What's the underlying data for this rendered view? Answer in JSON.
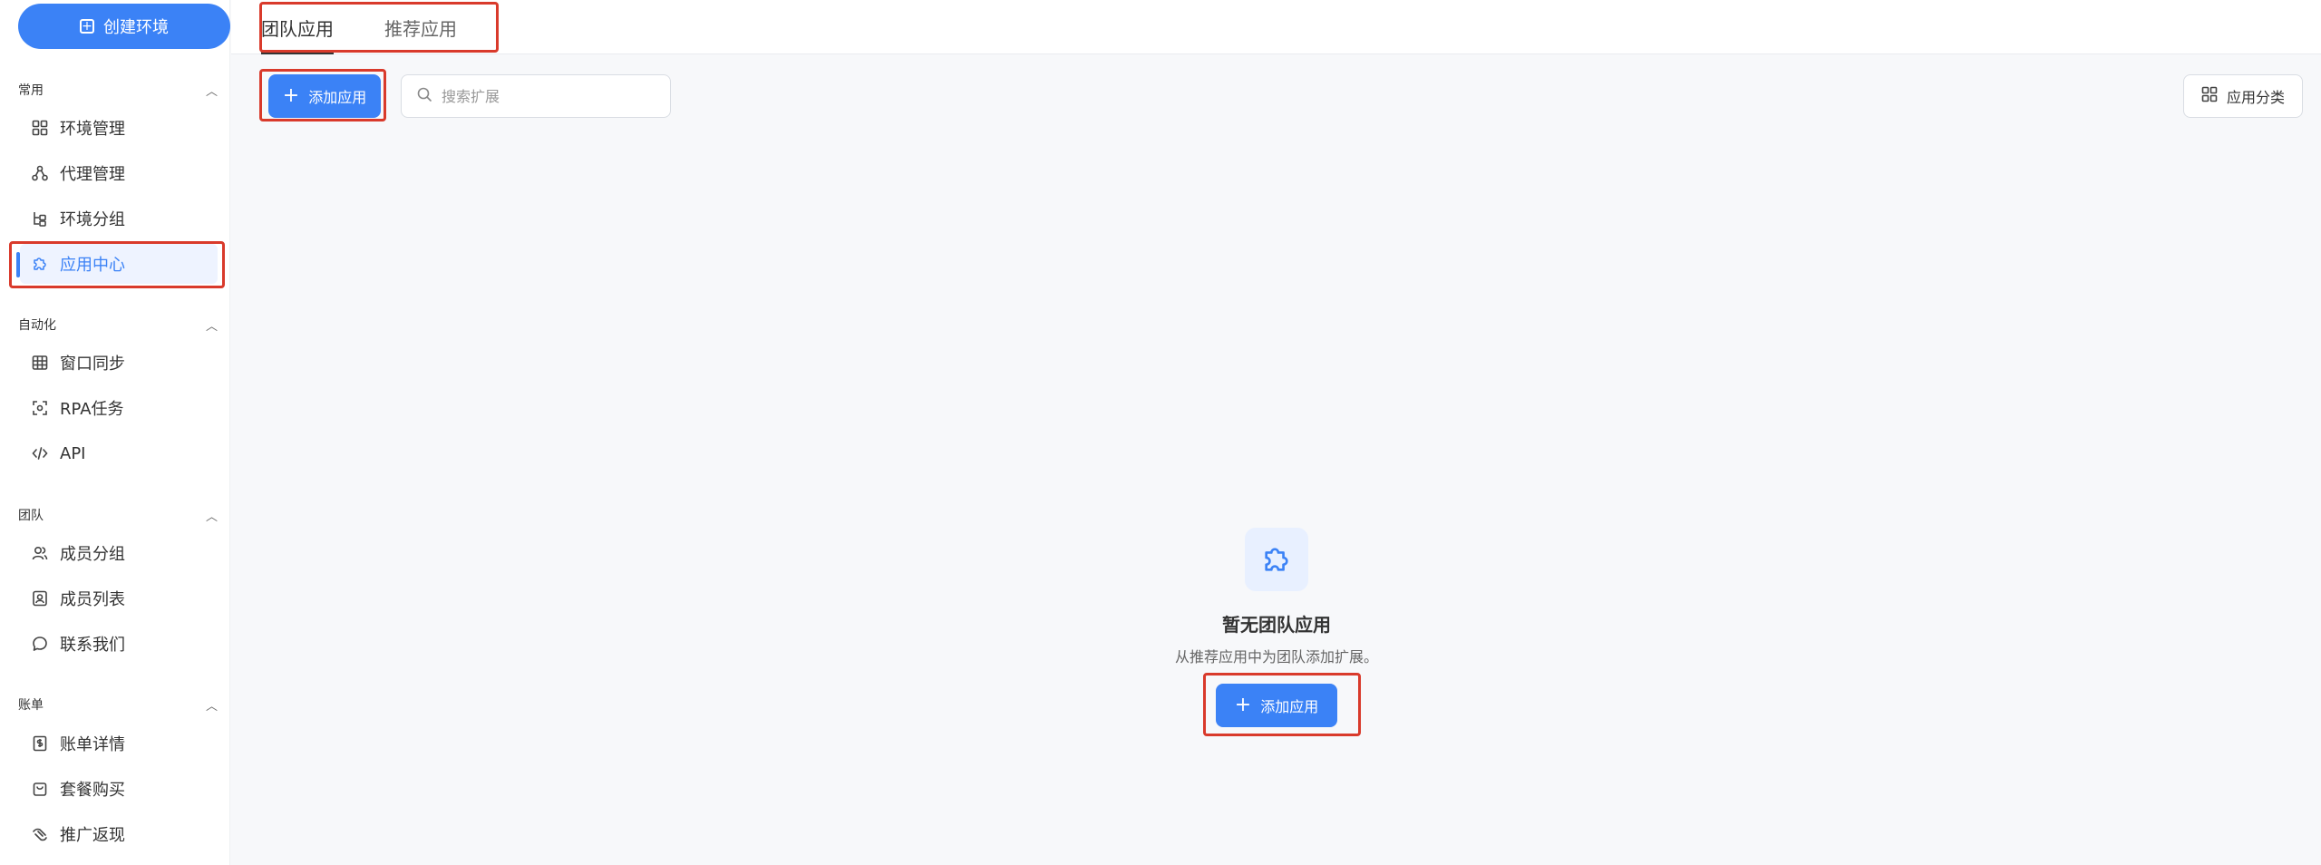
{
  "sidebar": {
    "create_button": "创建环境",
    "sections": [
      {
        "title": "常用",
        "items": [
          {
            "label": "环境管理",
            "icon": "grid-icon"
          },
          {
            "label": "代理管理",
            "icon": "network-icon"
          },
          {
            "label": "环境分组",
            "icon": "group-icon"
          },
          {
            "label": "应用中心",
            "icon": "puzzle-icon",
            "active": true
          }
        ]
      },
      {
        "title": "自动化",
        "items": [
          {
            "label": "窗口同步",
            "icon": "window-grid-icon"
          },
          {
            "label": "RPA任务",
            "icon": "scan-icon"
          },
          {
            "label": "API",
            "icon": "code-icon"
          }
        ]
      },
      {
        "title": "团队",
        "items": [
          {
            "label": "成员分组",
            "icon": "users-icon"
          },
          {
            "label": "成员列表",
            "icon": "contact-icon"
          },
          {
            "label": "联系我们",
            "icon": "chat-icon"
          }
        ]
      },
      {
        "title": "账单",
        "items": [
          {
            "label": "账单详情",
            "icon": "bill-icon"
          },
          {
            "label": "套餐购买",
            "icon": "bag-icon"
          },
          {
            "label": "推广返现",
            "icon": "share-icon"
          }
        ]
      }
    ]
  },
  "header": {
    "tabs": [
      {
        "label": "团队应用",
        "active": true
      },
      {
        "label": "推荐应用",
        "active": false
      }
    ]
  },
  "toolbar": {
    "add_label": "添加应用",
    "search_placeholder": "搜索扩展",
    "category_label": "应用分类"
  },
  "empty_state": {
    "title": "暂无团队应用",
    "description": "从推荐应用中为团队添加扩展。",
    "add_label": "添加应用"
  },
  "colors": {
    "accent": "#3b82f6",
    "highlight": "#d93a2b"
  }
}
